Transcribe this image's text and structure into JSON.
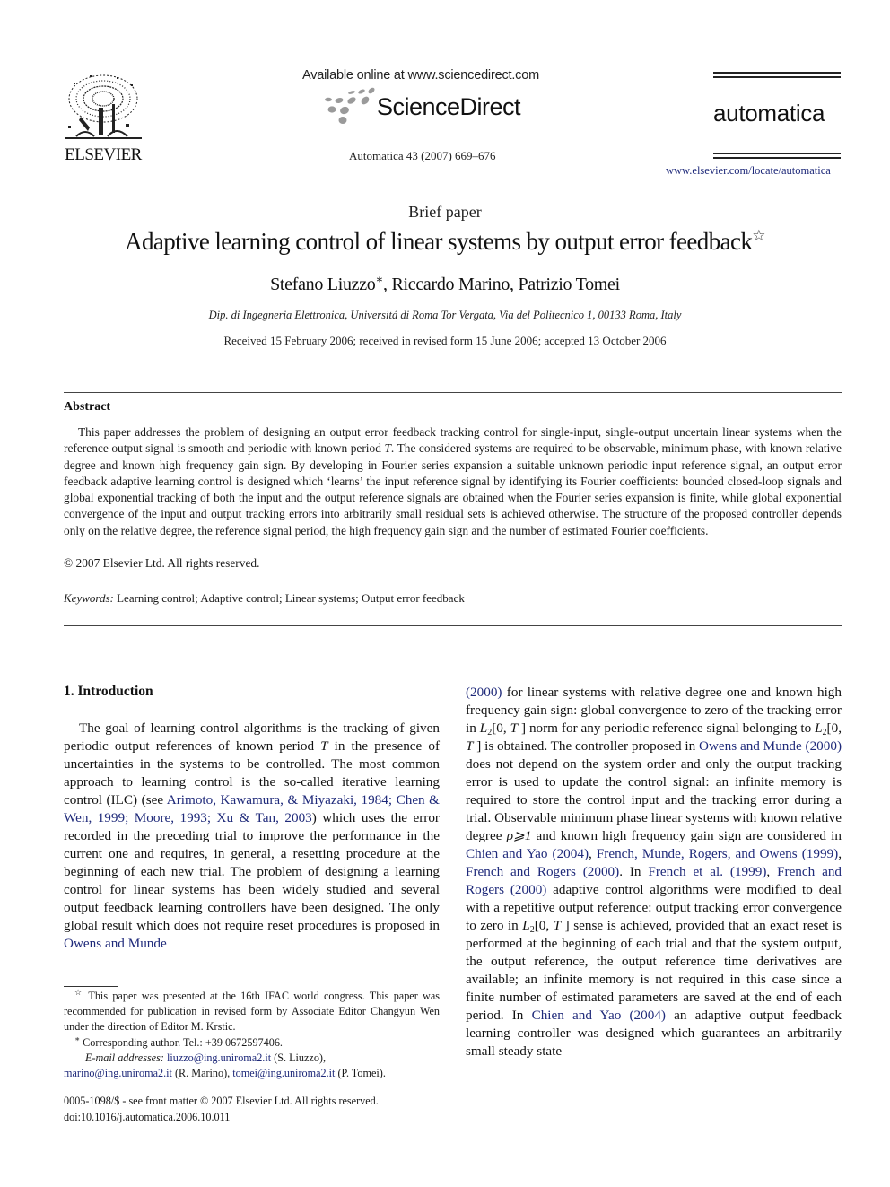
{
  "header": {
    "publisher_name": "ELSEVIER",
    "available_online": "Available online at www.sciencedirect.com",
    "sciencedirect_label": "ScienceDirect",
    "journal_reference": "Automatica 43 (2007) 669–676",
    "journal_name": "automatica",
    "journal_url": "www.elsevier.com/locate/automatica"
  },
  "article": {
    "type": "Brief paper",
    "title": "Adaptive learning control of linear systems by output error feedback",
    "title_footnote_mark": "☆",
    "authors": [
      {
        "name": "Stefano Liuzzo",
        "mark": "∗",
        "separator": ", "
      },
      {
        "name": "Riccardo Marino",
        "mark": "",
        "separator": ", "
      },
      {
        "name": "Patrizio Tomei",
        "mark": "",
        "separator": ""
      }
    ],
    "affiliation": "Dip. di Ingegneria Elettronica, Universitá di Roma Tor Vergata, Via del Politecnico 1, 00133 Roma, Italy",
    "dates": "Received 15 February 2006; received in revised form 15 June 2006; accepted 13 October 2006"
  },
  "abstract": {
    "heading": "Abstract",
    "text_part1": "This paper addresses the problem of designing an output error feedback tracking control for single-input, single-output uncertain linear systems when the reference output signal is smooth and periodic with known period ",
    "period_symbol": "T",
    "text_part2": ". The considered systems are required to be observable, minimum phase, with known relative degree and known high frequency gain sign. By developing in Fourier series expansion a suitable unknown periodic input reference signal, an output error feedback adaptive learning control is designed which ‘learns’ the input reference signal by identifying its Fourier coefficients: bounded closed-loop signals and global exponential tracking of both the input and the output reference signals are obtained when the Fourier series expansion is finite, while global exponential convergence of the input and output tracking errors into arbitrarily small residual sets is achieved otherwise. The structure of the proposed controller depends only on the relative degree, the reference signal period, the high frequency gain sign and the number of estimated Fourier coefficients.",
    "copyright": "© 2007 Elsevier Ltd. All rights reserved."
  },
  "keywords": {
    "label": "Keywords:",
    "list": "Learning control; Adaptive control; Linear systems; Output error feedback"
  },
  "introduction": {
    "heading": "1.  Introduction",
    "left": [
      {
        "t": "text",
        "v": "The goal of learning control algorithms is the tracking of given periodic output references of known period "
      },
      {
        "t": "italic",
        "v": "T"
      },
      {
        "t": "text",
        "v": " in the presence of uncertainties in the systems to be controlled. The most common approach to learning control is the so-called iterative learning control (ILC) (see "
      },
      {
        "t": "link",
        "v": "Arimoto, Kawamura, & Miyazaki, 1984; Chen & Wen, 1999; Moore, 1993; Xu & Tan, 2003"
      },
      {
        "t": "text",
        "v": ") which uses the error recorded in the preceding trial to improve the performance in the current one and requires, in general, a resetting procedure at the beginning of each new trial. The problem of designing a learning control for linear systems has been widely studied and several output feedback learning controllers have been designed. The only global result which does not require reset procedures is proposed in "
      },
      {
        "t": "link",
        "v": "Owens and Munde"
      }
    ],
    "right": [
      {
        "t": "link",
        "v": "(2000)"
      },
      {
        "t": "text",
        "v": " for linear systems with relative degree one and known high frequency gain sign: global convergence to zero of the tracking error in "
      },
      {
        "t": "math",
        "v": "L2[0, T]"
      },
      {
        "t": "text",
        "v": " norm for any periodic reference signal belonging to "
      },
      {
        "t": "math",
        "v": "L2[0, T]"
      },
      {
        "t": "text",
        "v": " is obtained. The controller proposed in "
      },
      {
        "t": "link",
        "v": "Owens and Munde (2000)"
      },
      {
        "t": "text",
        "v": " does not depend on the system order and only the output tracking error is used to update the control signal: an infinite memory is required to store the control input and the tracking error during a trial. Observable minimum phase linear systems with known relative degree "
      },
      {
        "t": "italic",
        "v": "ρ⩾1"
      },
      {
        "t": "text",
        "v": " and known high frequency gain sign are considered in "
      },
      {
        "t": "link",
        "v": "Chien and Yao (2004)"
      },
      {
        "t": "text",
        "v": ", "
      },
      {
        "t": "link",
        "v": "French, Munde, Rogers, and Owens (1999)"
      },
      {
        "t": "text",
        "v": ", "
      },
      {
        "t": "link",
        "v": "French and Rogers (2000)"
      },
      {
        "t": "text",
        "v": ". In "
      },
      {
        "t": "link",
        "v": "French et al. (1999)"
      },
      {
        "t": "text",
        "v": ", "
      },
      {
        "t": "link",
        "v": "French and Rogers (2000)"
      },
      {
        "t": "text",
        "v": " adaptive control algorithms were modified to deal with a repetitive output reference: output tracking error convergence to zero in "
      },
      {
        "t": "math",
        "v": "L2[0, T]"
      },
      {
        "t": "text",
        "v": " sense is achieved, provided that an exact reset is performed at the beginning of each trial and that the system output, the output reference, the output reference time derivatives are available; an infinite memory is not required in this case since a finite number of estimated parameters are saved at the end of each period. In "
      },
      {
        "t": "link",
        "v": "Chien and Yao (2004)"
      },
      {
        "t": "text",
        "v": " an adaptive output feedback learning controller was designed which guarantees an arbitrarily small steady state"
      }
    ]
  },
  "footnotes": {
    "star_mark": "☆",
    "star_note": "This paper was presented at the 16th IFAC world congress. This paper was recommended for publication in revised form by Associate Editor Changyun Wen under the direction of Editor M. Krstic.",
    "corr_mark": "∗",
    "corr_note": "Corresponding author. Tel.: +39 0672597406.",
    "email_label": "E-mail addresses:",
    "emails": [
      {
        "address": "liuzzo@ing.uniroma2.it",
        "who": " (S. Liuzzo),"
      },
      {
        "address": "marino@ing.uniroma2.it",
        "who": " (R. Marino), "
      },
      {
        "address": "tomei@ing.uniroma2.it",
        "who": " (P. Tomei)."
      }
    ]
  },
  "front_matter": {
    "issn_line": "0005-1098/$ - see front matter © 2007 Elsevier Ltd. All rights reserved.",
    "doi": "doi:10.1016/j.automatica.2006.10.011"
  },
  "colors": {
    "link": "#1f2a7a",
    "text": "#111111"
  }
}
